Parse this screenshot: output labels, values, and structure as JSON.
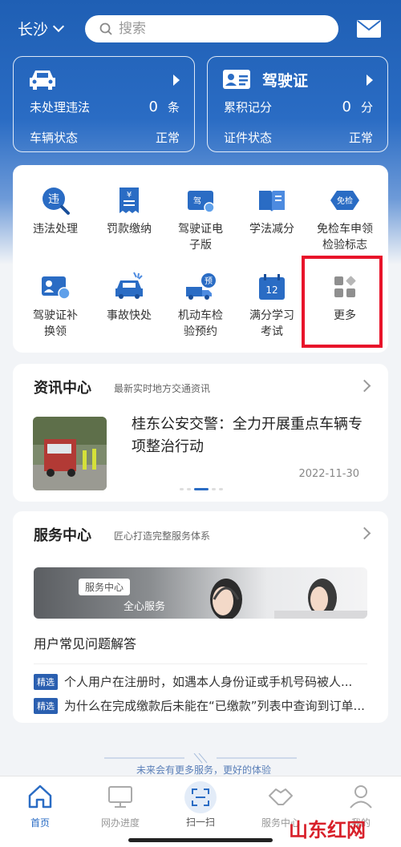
{
  "header": {
    "city": "长沙",
    "search_placeholder": "搜索"
  },
  "violation_card": {
    "row1_label": "未处理违法",
    "row1_value": "0",
    "row1_unit": "条",
    "row2_label": "车辆状态",
    "row2_value": "正常"
  },
  "license_card": {
    "title": "驾驶证",
    "row1_label": "累积记分",
    "row1_value": "0",
    "row1_unit": "分",
    "row2_label": "证件状态",
    "row2_value": "正常"
  },
  "services": [
    {
      "label1": "违法处理",
      "label2": "",
      "badge": "违"
    },
    {
      "label1": "罚款缴纳",
      "label2": "",
      "badge": "¥"
    },
    {
      "label1": "驾驶证电",
      "label2": "子版",
      "badge": "驾"
    },
    {
      "label1": "学法减分",
      "label2": "",
      "badge": ""
    },
    {
      "label1": "免检车申领",
      "label2": "检验标志",
      "badge": "免检"
    },
    {
      "label1": "驾驶证补",
      "label2": "换领",
      "badge": ""
    },
    {
      "label1": "事故快处",
      "label2": "",
      "badge": ""
    },
    {
      "label1": "机动车检",
      "label2": "验预约",
      "badge": "预"
    },
    {
      "label1": "满分学习",
      "label2": "考试",
      "badge": "12"
    },
    {
      "label1": "更多",
      "label2": "",
      "badge": ""
    }
  ],
  "news": {
    "title": "资讯中心",
    "subtitle": "最新实时地方交通资讯",
    "headline": "桂东公安交警：全力开展重点车辆专项整治行动",
    "date": "2022-11-30"
  },
  "service_center": {
    "title": "服务中心",
    "subtitle": "匠心打造完整服务体系",
    "banner_tag": "服务中心",
    "banner_text": "全心服务",
    "faq_title": "用户常见问题解答",
    "faq": [
      {
        "tag": "精选",
        "text": "个人用户在注册时，如遇本人身份证或手机号码被人..."
      },
      {
        "tag": "精选",
        "text": "为什么在完成缴款后未能在“已缴款”列表中查询到订单..."
      }
    ]
  },
  "slogan": "未来会有更多服务，更好的体验",
  "tabs": [
    {
      "label": "首页"
    },
    {
      "label": "网办进度"
    },
    {
      "label": "扫一扫"
    },
    {
      "label": "服务中心"
    },
    {
      "label": "我的"
    }
  ],
  "watermark": "山东红网",
  "colors": {
    "primary": "#2a6cc4",
    "highlight": "#e8132a"
  }
}
